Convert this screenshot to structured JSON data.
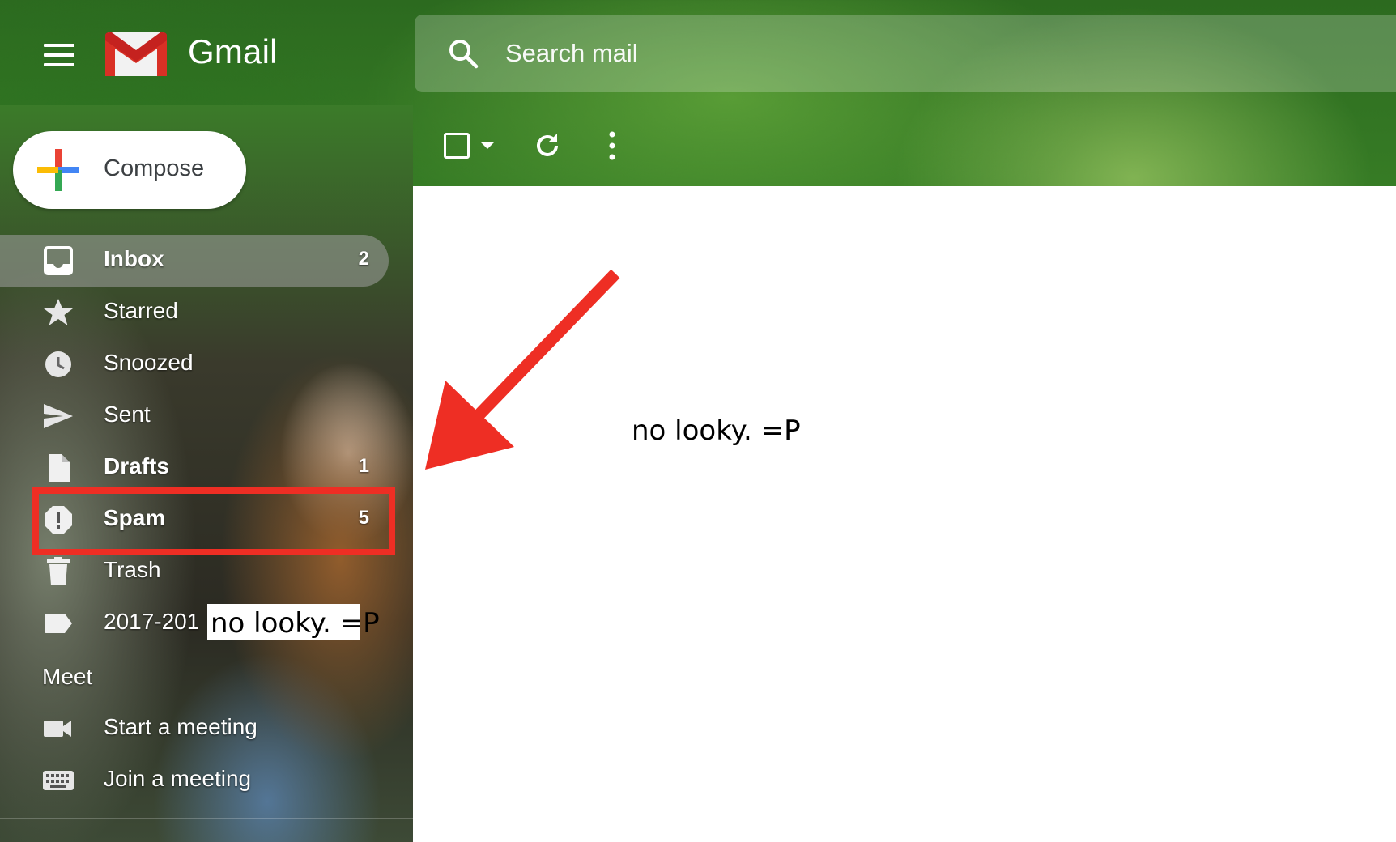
{
  "header": {
    "brand": "Gmail",
    "search": {
      "placeholder": "Search mail"
    }
  },
  "compose": {
    "label": "Compose"
  },
  "nav": {
    "items": [
      {
        "id": "inbox",
        "label": "Inbox",
        "count": "2",
        "bold": true,
        "active": true,
        "icon": "inbox-icon"
      },
      {
        "id": "starred",
        "label": "Starred",
        "count": "",
        "icon": "star-icon"
      },
      {
        "id": "snoozed",
        "label": "Snoozed",
        "count": "",
        "icon": "clock-icon"
      },
      {
        "id": "sent",
        "label": "Sent",
        "count": "",
        "icon": "send-icon"
      },
      {
        "id": "drafts",
        "label": "Drafts",
        "count": "1",
        "bold": true,
        "icon": "draft-icon"
      },
      {
        "id": "spam",
        "label": "Spam",
        "count": "5",
        "bold": true,
        "icon": "report-icon"
      },
      {
        "id": "trash",
        "label": "Trash",
        "count": "",
        "icon": "trash-icon"
      },
      {
        "id": "label-2017",
        "label": "2017-201",
        "count": "",
        "icon": "label-icon"
      }
    ],
    "redaction_text": "no looky. =P"
  },
  "meet": {
    "heading": "Meet",
    "items": [
      {
        "id": "start",
        "label": "Start a meeting",
        "icon": "video-icon"
      },
      {
        "id": "join",
        "label": "Join a meeting",
        "icon": "keyboard-icon"
      }
    ]
  },
  "main": {
    "redaction_text": "no looky. =P"
  },
  "colors": {
    "annotation_red": "#ee2e24",
    "gmail_red": "#d93025"
  }
}
